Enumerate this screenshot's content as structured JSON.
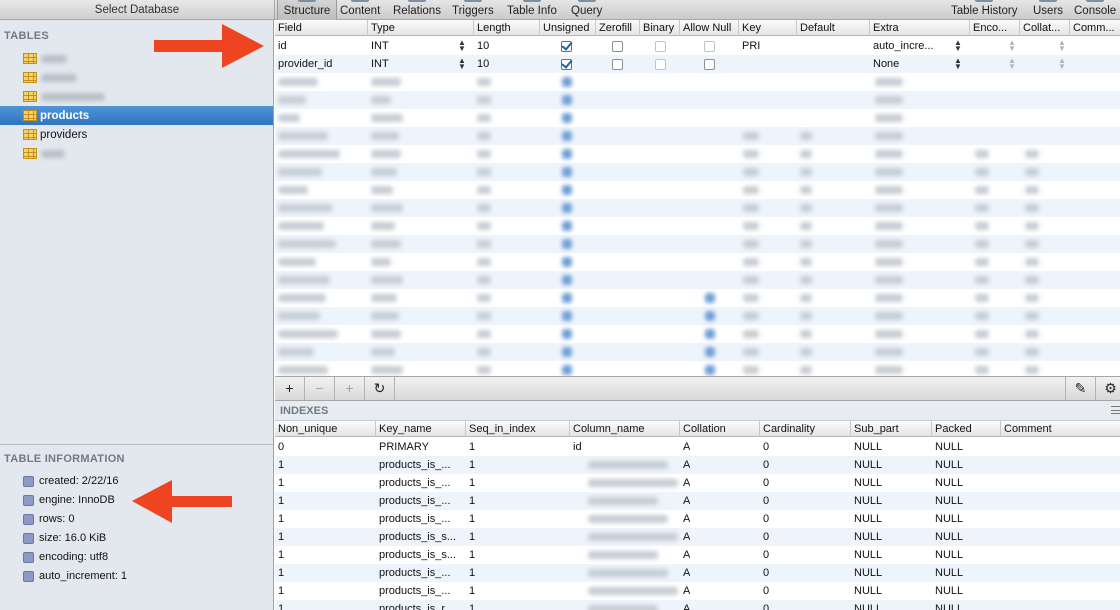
{
  "left_header": {
    "title": "Select Database"
  },
  "toolbar": {
    "tabs": [
      {
        "label": "Structure",
        "active": true
      },
      {
        "label": "Content"
      },
      {
        "label": "Relations"
      },
      {
        "label": "Triggers"
      },
      {
        "label": "Table Info"
      },
      {
        "label": "Query"
      }
    ],
    "right": [
      {
        "label": "Table History"
      },
      {
        "label": "Users"
      },
      {
        "label": "Console"
      }
    ]
  },
  "sidebar": {
    "tables_heading": "TABLES",
    "tables": [
      {
        "label": ""
      },
      {
        "label": ""
      },
      {
        "label": ""
      },
      {
        "label": "products",
        "selected": true
      },
      {
        "label": "providers"
      },
      {
        "label": ""
      }
    ],
    "info_heading": "TABLE INFORMATION",
    "info": [
      {
        "label": "created: 2/22/16"
      },
      {
        "label": "engine: InnoDB"
      },
      {
        "label": "rows: 0"
      },
      {
        "label": "size: 16.0 KiB"
      },
      {
        "label": "encoding: utf8"
      },
      {
        "label": "auto_increment: 1"
      }
    ]
  },
  "structure": {
    "columns": [
      "Field",
      "Type",
      "Length",
      "Unsigned",
      "Zerofill",
      "Binary",
      "Allow Null",
      "Key",
      "Default",
      "Extra",
      "Enco...",
      "Collat...",
      "Comm..."
    ],
    "rows": [
      {
        "field": "id",
        "type": "INT",
        "length": "10",
        "unsigned": true,
        "zerofill": false,
        "binary": false,
        "allow_null": false,
        "key": "PRI",
        "default": "",
        "extra": "auto_incre..."
      },
      {
        "field": "provider_id",
        "type": "INT",
        "length": "10",
        "unsigned": true,
        "zerofill": false,
        "binary": false,
        "allow_null": false,
        "key": "",
        "default": "",
        "extra": "None"
      }
    ]
  },
  "buttons": {
    "add": "+",
    "remove": "−",
    "duplicate": "+",
    "refresh": "↻",
    "edit": "✎",
    "gear": "⚙"
  },
  "indexes": {
    "title": "INDEXES",
    "columns": [
      "Non_unique",
      "Key_name",
      "Seq_in_index",
      "Column_name",
      "Collation",
      "Cardinality",
      "Sub_part",
      "Packed",
      "Comment"
    ],
    "rows": [
      {
        "non_unique": "0",
        "key_name": "PRIMARY",
        "seq": "1",
        "column": "id",
        "collation": "A",
        "cardinality": "0",
        "sub_part": "NULL",
        "packed": "NULL",
        "comment": ""
      },
      {
        "non_unique": "1",
        "key_name": "products_is_...",
        "seq": "1",
        "column": "",
        "collation": "A",
        "cardinality": "0",
        "sub_part": "NULL",
        "packed": "NULL",
        "comment": ""
      },
      {
        "non_unique": "1",
        "key_name": "products_is_...",
        "seq": "1",
        "column": "",
        "collation": "A",
        "cardinality": "0",
        "sub_part": "NULL",
        "packed": "NULL",
        "comment": ""
      },
      {
        "non_unique": "1",
        "key_name": "products_is_...",
        "seq": "1",
        "column": "",
        "collation": "A",
        "cardinality": "0",
        "sub_part": "NULL",
        "packed": "NULL",
        "comment": ""
      },
      {
        "non_unique": "1",
        "key_name": "products_is_...",
        "seq": "1",
        "column": "",
        "collation": "A",
        "cardinality": "0",
        "sub_part": "NULL",
        "packed": "NULL",
        "comment": ""
      },
      {
        "non_unique": "1",
        "key_name": "products_is_s...",
        "seq": "1",
        "column": "",
        "collation": "A",
        "cardinality": "0",
        "sub_part": "NULL",
        "packed": "NULL",
        "comment": ""
      },
      {
        "non_unique": "1",
        "key_name": "products_is_s...",
        "seq": "1",
        "column": "",
        "collation": "A",
        "cardinality": "0",
        "sub_part": "NULL",
        "packed": "NULL",
        "comment": ""
      },
      {
        "non_unique": "1",
        "key_name": "products_is_...",
        "seq": "1",
        "column": "",
        "collation": "A",
        "cardinality": "0",
        "sub_part": "NULL",
        "packed": "NULL",
        "comment": ""
      },
      {
        "non_unique": "1",
        "key_name": "products_is_...",
        "seq": "1",
        "column": "",
        "collation": "A",
        "cardinality": "0",
        "sub_part": "NULL",
        "packed": "NULL",
        "comment": ""
      },
      {
        "non_unique": "1",
        "key_name": "products_is_r...",
        "seq": "1",
        "column": "",
        "collation": "A",
        "cardinality": "0",
        "sub_part": "NULL",
        "packed": "NULL",
        "comment": ""
      }
    ]
  },
  "colors": {
    "selection": "#3a80c9",
    "sidebar_bg": "#e3e8ee",
    "arrow": "#ee4422"
  }
}
